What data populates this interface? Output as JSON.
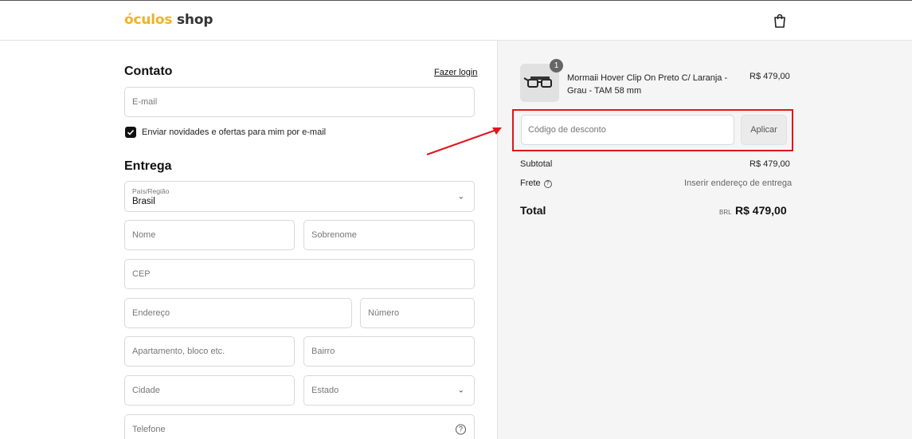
{
  "header": {
    "logo_part1": "óculos",
    "logo_part2": "shop",
    "cart_icon": "shopping-bag-icon"
  },
  "contact": {
    "title": "Contato",
    "login_link": "Fazer login",
    "email_placeholder": "E-mail",
    "newsletter_checked": true,
    "newsletter_label": "Enviar novidades e ofertas para mim por e-mail"
  },
  "delivery": {
    "title": "Entrega",
    "country_label": "País/Região",
    "country_value": "Brasil",
    "first_name_placeholder": "Nome",
    "last_name_placeholder": "Sobrenome",
    "cep_placeholder": "CEP",
    "address_placeholder": "Endereço",
    "number_placeholder": "Número",
    "apartment_placeholder": "Apartamento, bloco etc.",
    "district_placeholder": "Bairro",
    "city_placeholder": "Cidade",
    "state_placeholder": "Estado",
    "phone_placeholder": "Telefone"
  },
  "summary": {
    "product": {
      "quantity": "1",
      "name": "Mormaii Hover Clip On Preto C/ Laranja - Grau - TAM 58 mm",
      "price": "R$ 479,00"
    },
    "discount_placeholder": "Código de desconto",
    "apply_label": "Aplicar",
    "subtotal_label": "Subtotal",
    "subtotal_value": "R$ 479,00",
    "shipping_label": "Frete",
    "shipping_value": "Inserir endereço de entrega",
    "total_label": "Total",
    "currency": "BRL",
    "total_value": "R$ 479,00"
  },
  "colors": {
    "logo_accent": "#f0b225",
    "highlight_box": "#e0161b",
    "summary_bg": "#f5f5f5"
  }
}
